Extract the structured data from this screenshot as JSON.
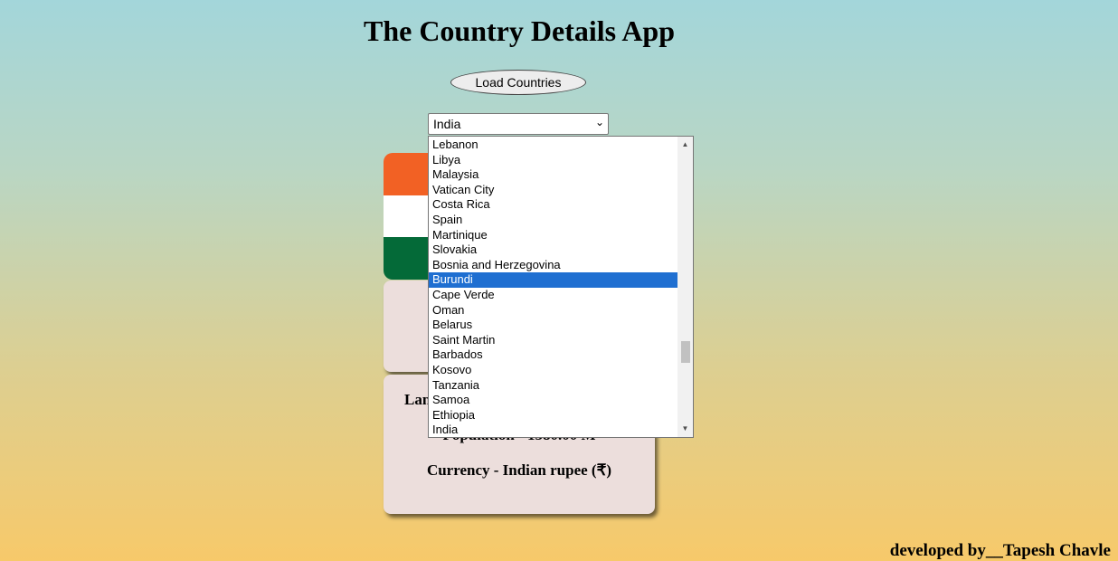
{
  "app": {
    "title": "The Country Details App",
    "load_button": "Load Countries"
  },
  "select": {
    "value": "India",
    "options": [
      "Lebanon",
      "Libya",
      "Malaysia",
      "Vatican City",
      "Costa Rica",
      "Spain",
      "Martinique",
      "Slovakia",
      "Bosnia and Herzegovina",
      "Burundi",
      "Cape Verde",
      "Oman",
      "Belarus",
      "Saint Martin",
      "Barbados",
      "Kosovo",
      "Tanzania",
      "Samoa",
      "Ethiopia",
      "India"
    ],
    "highlighted": "Burundi"
  },
  "flag": {
    "colors": [
      "#f26124",
      "#ffffff",
      "#046a38"
    ]
  },
  "details": {
    "language_partial": "Lan",
    "population": "Population - 1380.00 M",
    "currency": "Currency - Indian rupee (₹)"
  },
  "footer": {
    "credit": "developed by__Tapesh Chavle"
  },
  "colors": {
    "highlight": "#1f6fd1",
    "card": "#ecdedc"
  }
}
